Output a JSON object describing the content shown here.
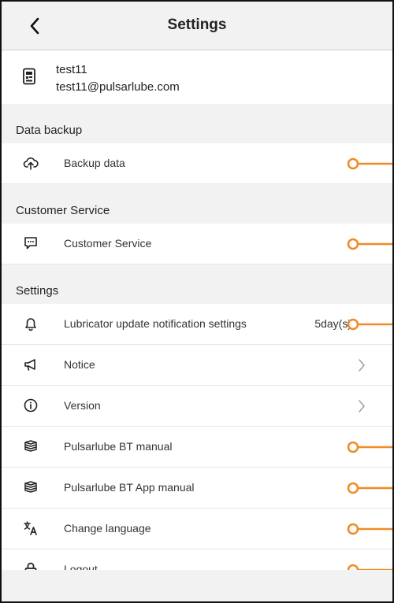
{
  "header": {
    "title": "Settings"
  },
  "user": {
    "name": "test11",
    "email": "test11@pulsarlube.com"
  },
  "sections": {
    "data_backup": {
      "title": "Data backup",
      "rows": [
        {
          "label": "Backup data",
          "icon": "cloud-upload-icon"
        }
      ]
    },
    "customer_service": {
      "title": "Customer Service",
      "rows": [
        {
          "label": "Customer Service",
          "icon": "chat-icon"
        }
      ]
    },
    "settings": {
      "title": "Settings",
      "rows": [
        {
          "label": "Lubricator update notification settings",
          "icon": "bell-icon",
          "value": "5day(s)"
        },
        {
          "label": "Notice",
          "icon": "megaphone-icon"
        },
        {
          "label": "Version",
          "icon": "info-icon"
        },
        {
          "label": "Pulsarlube BT manual",
          "icon": "book-icon"
        },
        {
          "label": "Pulsarlube BT App manual",
          "icon": "book-icon"
        },
        {
          "label": "Change language",
          "icon": "translate-icon"
        },
        {
          "label": "Logout",
          "icon": "lock-icon"
        }
      ]
    }
  },
  "colors": {
    "accent": "#F08A24",
    "background": "#f2f2f2",
    "row": "#ffffff"
  }
}
